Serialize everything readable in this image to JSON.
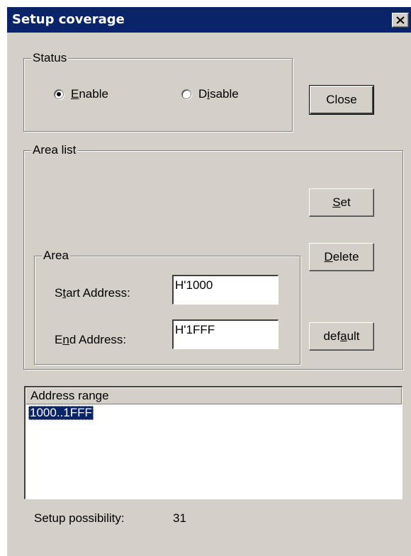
{
  "window": {
    "title": "Setup coverage",
    "close_glyph": "✕"
  },
  "status_group": {
    "label": "Status",
    "enable_label": "Enable",
    "disable_label": "Disable",
    "selected": "Enable"
  },
  "buttons": {
    "close": "Close",
    "set": "Set",
    "delete": "Delete",
    "default": "default"
  },
  "area_list_group": {
    "label": "Area list"
  },
  "area_group": {
    "label": "Area",
    "start_label": "Start Address:",
    "start_value": "H'1000",
    "end_label": "End Address:",
    "end_value": "H'1FFF"
  },
  "address_list": {
    "header": "Address range",
    "rows": [
      "1000..1FFF"
    ],
    "selected_row": "1000..1FFF"
  },
  "footer": {
    "label": "Setup possibility:",
    "value": "31"
  },
  "colors": {
    "titlebar": "#0a246a",
    "dialog_bg": "#d4d0c8",
    "selection": "#0a246a"
  }
}
